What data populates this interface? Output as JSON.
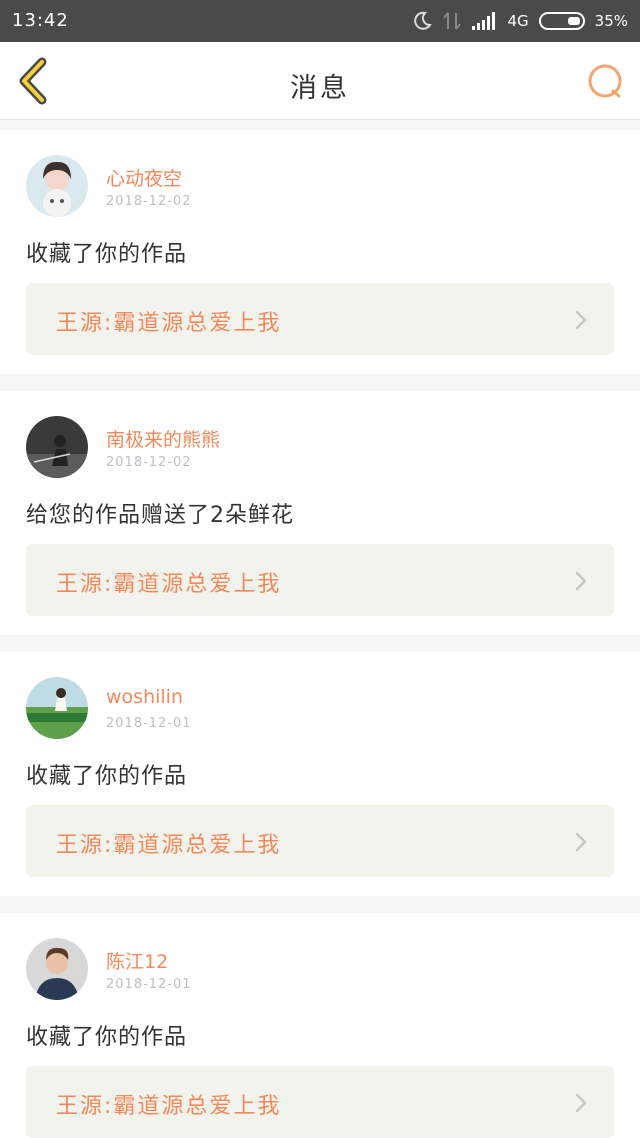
{
  "status_bar": {
    "time": "13:42",
    "network": "4G",
    "battery": "35%"
  },
  "header": {
    "title": "消息"
  },
  "messages": [
    {
      "user": "心动夜空",
      "date": "2018-12-02",
      "action": "收藏了你的作品",
      "work": "王源:霸道源总爱上我"
    },
    {
      "user": "南极来的熊熊",
      "date": "2018-12-02",
      "action": "给您的作品赠送了2朵鲜花",
      "work": "王源:霸道源总爱上我"
    },
    {
      "user": "woshilin",
      "date": "2018-12-01",
      "action": "收藏了你的作品",
      "work": "王源:霸道源总爱上我"
    },
    {
      "user": "陈江12",
      "date": "2018-12-01",
      "action": "收藏了你的作品",
      "work": "王源:霸道源总爱上我"
    }
  ]
}
